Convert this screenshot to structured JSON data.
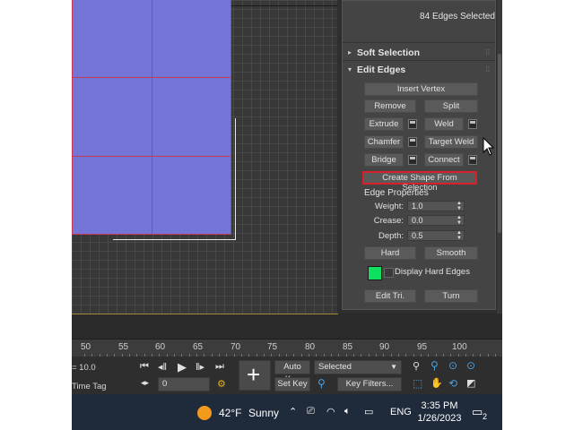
{
  "panel": {
    "selection_info": "84 Edges Selected",
    "soft_selection": "Soft Selection",
    "edit_edges": "Edit Edges",
    "insert_vertex": "Insert Vertex",
    "remove": "Remove",
    "split": "Split",
    "extrude": "Extrude",
    "weld": "Weld",
    "chamfer": "Chamfer",
    "target_weld": "Target Weld",
    "bridge": "Bridge",
    "connect": "Connect",
    "create_shape": "Create Shape From Selection",
    "edge_properties": "Edge Properties",
    "weight_label": "Weight:",
    "weight_value": "1.0",
    "crease_label": "Crease:",
    "crease_value": "0.0",
    "depth_label": "Depth:",
    "depth_value": "0.5",
    "hard": "Hard",
    "smooth": "Smooth",
    "display_hard_edges": "Display Hard Edges",
    "edit_tri": "Edit Tri.",
    "turn": "Turn",
    "swatch_color": "#10e060"
  },
  "timeline": {
    "ticks": [
      "50",
      "55",
      "60",
      "65",
      "70",
      "75",
      "80",
      "85",
      "90",
      "95",
      "100"
    ]
  },
  "toolbar": {
    "value_text": "= 10.0",
    "time_tag": "Time Tag",
    "frame_value": "0",
    "auto_key": "Auto Key",
    "set_key": "Set Key",
    "selected": "Selected",
    "key_filters": "Key Filters..."
  },
  "taskbar": {
    "temperature": "42°F",
    "weather": "Sunny",
    "language": "ENG",
    "time": "3:35 PM",
    "date": "1/26/2023",
    "notifications": "2"
  },
  "colors": {
    "mesh": "#7575d8",
    "edge": "#c43a58",
    "highlight": "#d8202a"
  }
}
